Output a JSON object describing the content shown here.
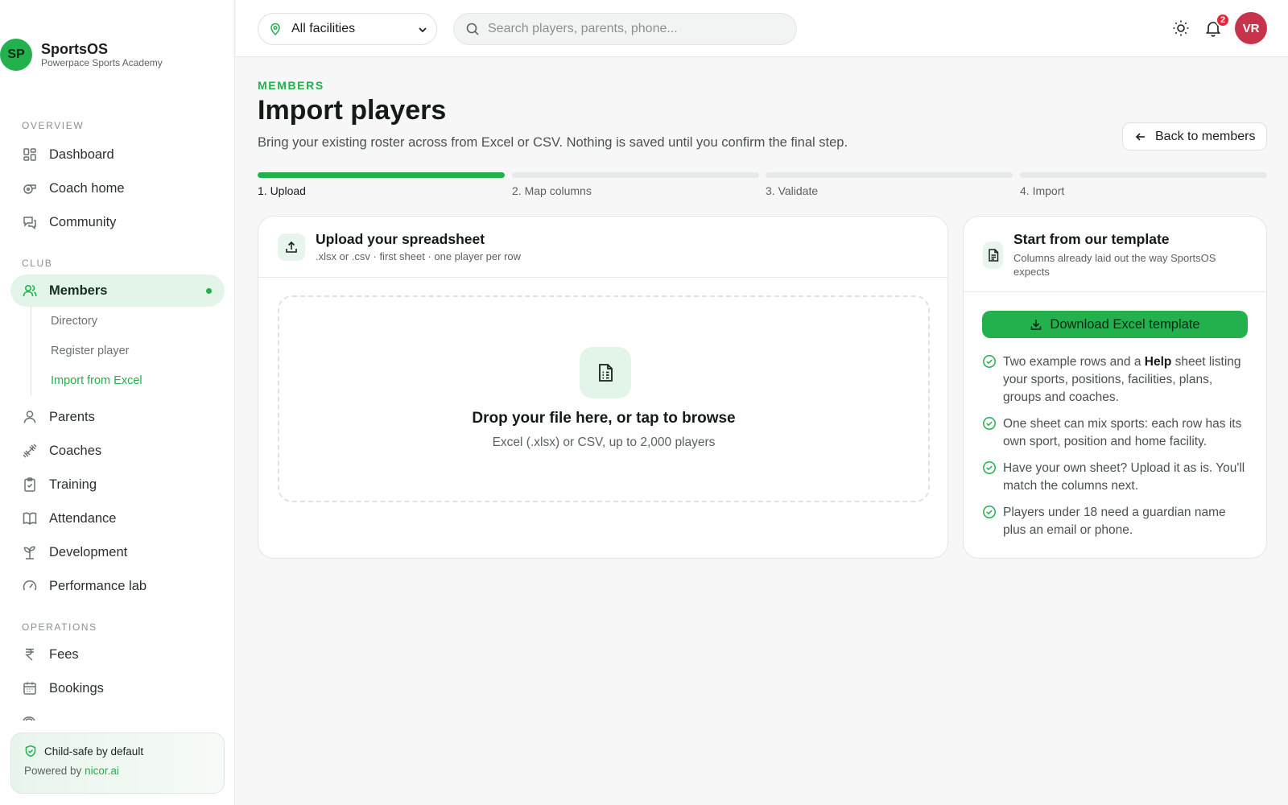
{
  "brand": {
    "initials": "SP",
    "name": "SportsOS",
    "academy": "Powerpace Sports Academy"
  },
  "sidebar": {
    "sections": {
      "overview": "OVERVIEW",
      "club": "CLUB",
      "operations": "OPERATIONS"
    },
    "overview_items": [
      {
        "label": "Dashboard",
        "icon": "grid-icon"
      },
      {
        "label": "Coach home",
        "icon": "whistle-icon"
      },
      {
        "label": "Community",
        "icon": "chat-icon"
      }
    ],
    "club_items": [
      {
        "label": "Members",
        "icon": "users-icon",
        "active": true
      },
      {
        "label": "Parents",
        "icon": "user-icon"
      },
      {
        "label": "Coaches",
        "icon": "dumbbell-icon"
      },
      {
        "label": "Training",
        "icon": "clipboard-icon"
      },
      {
        "label": "Attendance",
        "icon": "book-icon"
      },
      {
        "label": "Development",
        "icon": "sprout-icon"
      },
      {
        "label": "Performance lab",
        "icon": "gauge-icon"
      }
    ],
    "members_sub": [
      {
        "label": "Directory"
      },
      {
        "label": "Register player"
      },
      {
        "label": "Import from Excel",
        "active": true
      }
    ],
    "operations_items": [
      {
        "label": "Fees",
        "icon": "rupee-icon"
      },
      {
        "label": "Bookings",
        "icon": "calendar-icon"
      }
    ],
    "safe_card": {
      "title": "Child-safe by default",
      "powered_prefix": "Powered by",
      "powered_link": "nicor.ai"
    }
  },
  "topbar": {
    "facility": "All facilities",
    "search_placeholder": "Search players, parents, phone...",
    "notification_count": "2",
    "user_initials": "VR"
  },
  "page": {
    "eyebrow": "MEMBERS",
    "title": "Import players",
    "subtitle": "Bring your existing roster across from Excel or CSV. Nothing is saved until you confirm the final step.",
    "back_label": "Back to members"
  },
  "steps": [
    {
      "label": "1. Upload",
      "done": true
    },
    {
      "label": "2. Map columns",
      "done": false
    },
    {
      "label": "3. Validate",
      "done": false
    },
    {
      "label": "4. Import",
      "done": false
    }
  ],
  "upload": {
    "title": "Upload your spreadsheet",
    "subtitle": ".xlsx or .csv · first sheet · one player per row",
    "drop_title": "Drop your file here, or tap to browse",
    "drop_sub": "Excel (.xlsx) or CSV, up to 2,000 players"
  },
  "template": {
    "title": "Start from our template",
    "subtitle": "Columns already laid out the way SportsOS expects",
    "download_label": "Download Excel template",
    "bullets": [
      {
        "pre": "Two example rows and a ",
        "bold": "Help",
        "post": " sheet listing your sports, positions, facilities, plans, groups and coaches."
      },
      {
        "pre": "One sheet can mix sports: each row has its own sport, position and home facility.",
        "bold": "",
        "post": ""
      },
      {
        "pre": "Have your own sheet? Upload it as is. You'll match the columns next.",
        "bold": "",
        "post": ""
      },
      {
        "pre": "Players under 18 need a guardian name plus an email or phone.",
        "bold": "",
        "post": ""
      }
    ]
  },
  "colors": {
    "accent": "#22b14c",
    "active_bg": "#e3f5e8",
    "badge": "#e0283a",
    "avatar": "#c8334c"
  }
}
